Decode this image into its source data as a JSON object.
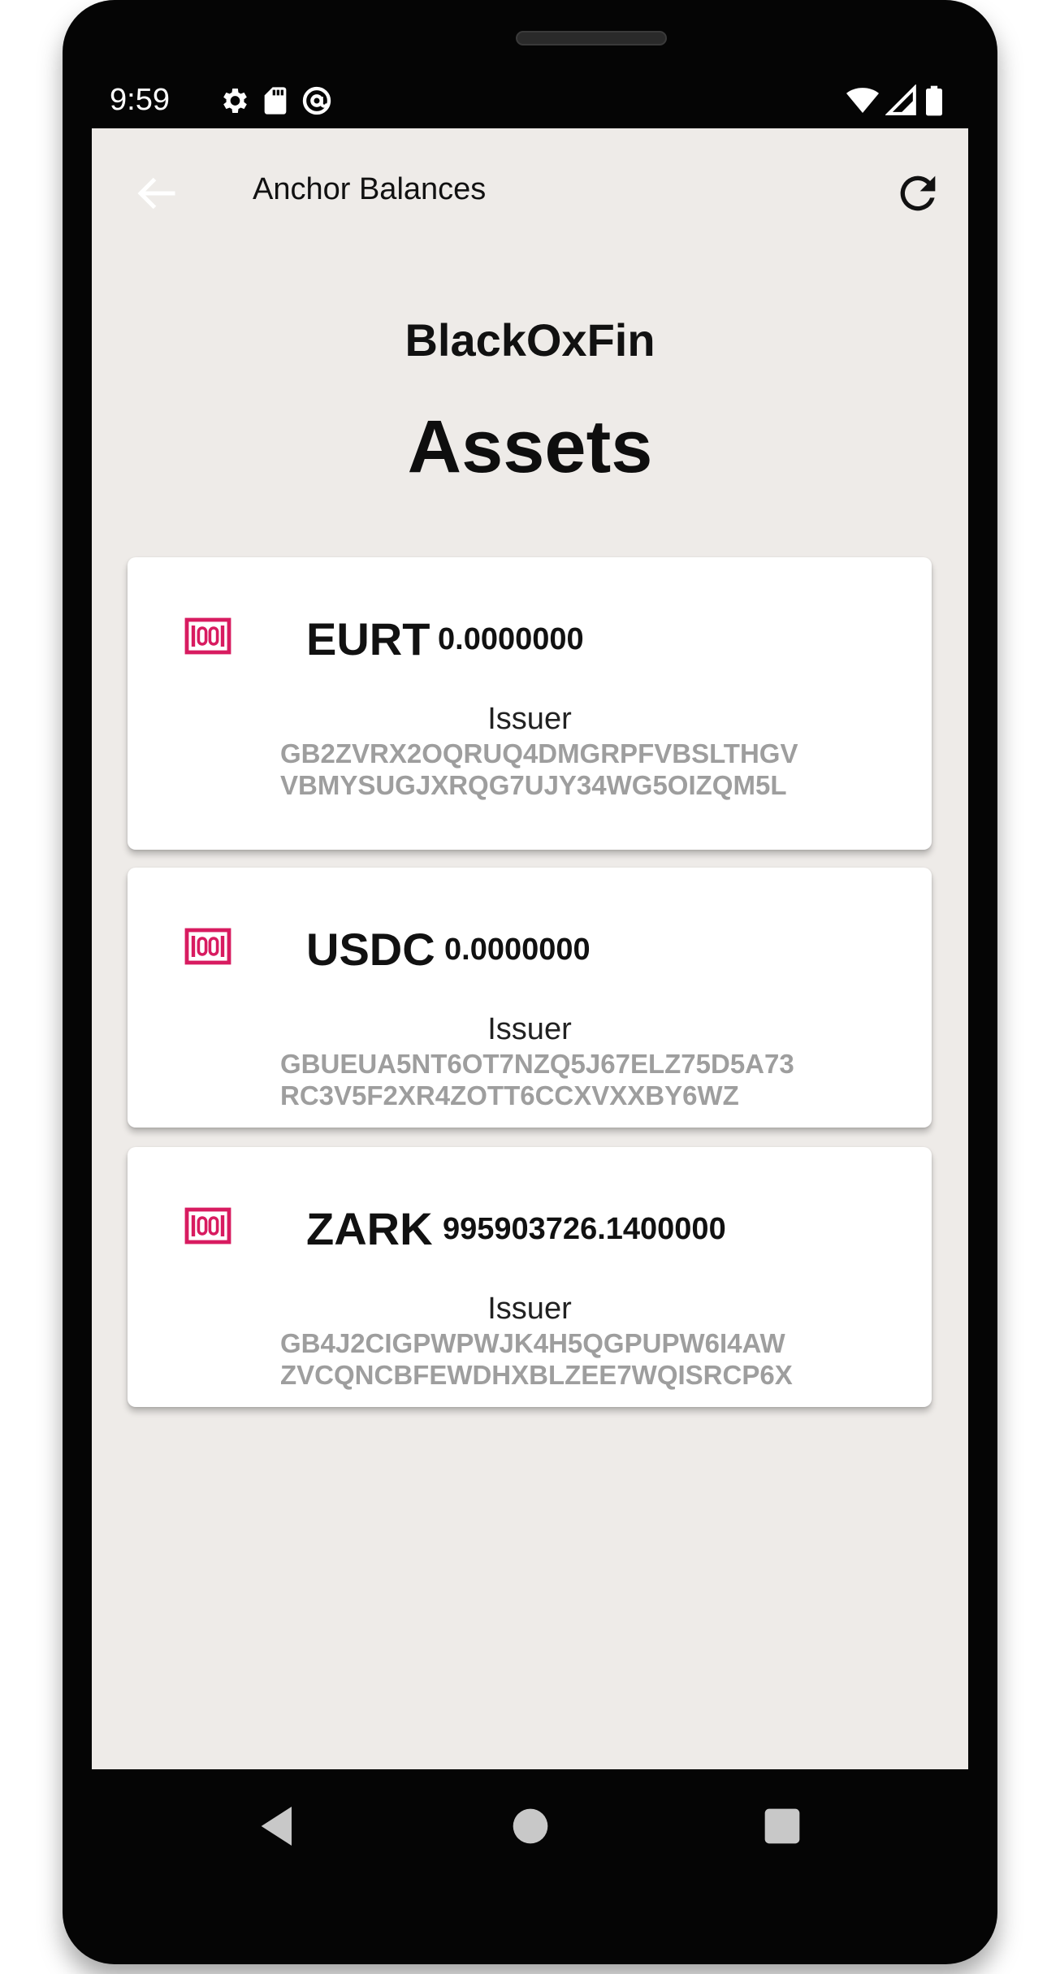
{
  "status_bar": {
    "time": "9:59",
    "left_icons": [
      "gear-icon",
      "sd-card-icon",
      "at-sign-icon"
    ],
    "right_icons": [
      "wifi-icon",
      "signal-icon",
      "battery-icon"
    ]
  },
  "app_bar": {
    "title": "Anchor Balances",
    "back_icon": "arrow-left-icon",
    "refresh_icon": "refresh-icon"
  },
  "anchor": {
    "name": "BlackOxFin"
  },
  "section": {
    "title": "Assets"
  },
  "assets": [
    {
      "code": "EURT",
      "balance": "0.0000000",
      "issuer_label": "Issuer",
      "issuer": "GB2ZVRX2OQRUQ4DMGRPFVBSLTHGVVBMYSUGJXRQG7UJY34WG5OIZQM5L",
      "icon": "money-icon"
    },
    {
      "code": "USDC",
      "balance": "0.0000000",
      "issuer_label": "Issuer",
      "issuer": "GBUEUA5NT6OT7NZQ5J67ELZ75D5A73RC3V5F2XR4ZOTT6CCXVXXBY6WZ",
      "icon": "money-icon"
    },
    {
      "code": "ZARK",
      "balance": "995903726.1400000",
      "issuer_label": "Issuer",
      "issuer": "GB4J2CIGPWPWJK4H5QGPUPW6I4AWZVCQNCBFEWDHXBLZEE7WQISRCP6X",
      "icon": "money-icon"
    }
  ],
  "nav_bar": {
    "back": "triangle-back-icon",
    "home": "circle-home-icon",
    "recents": "square-recents-icon"
  },
  "colors": {
    "screen_bg": "#eeebe8",
    "accent_icon": "#d81b60",
    "issuer_text": "#9e9e9e"
  }
}
